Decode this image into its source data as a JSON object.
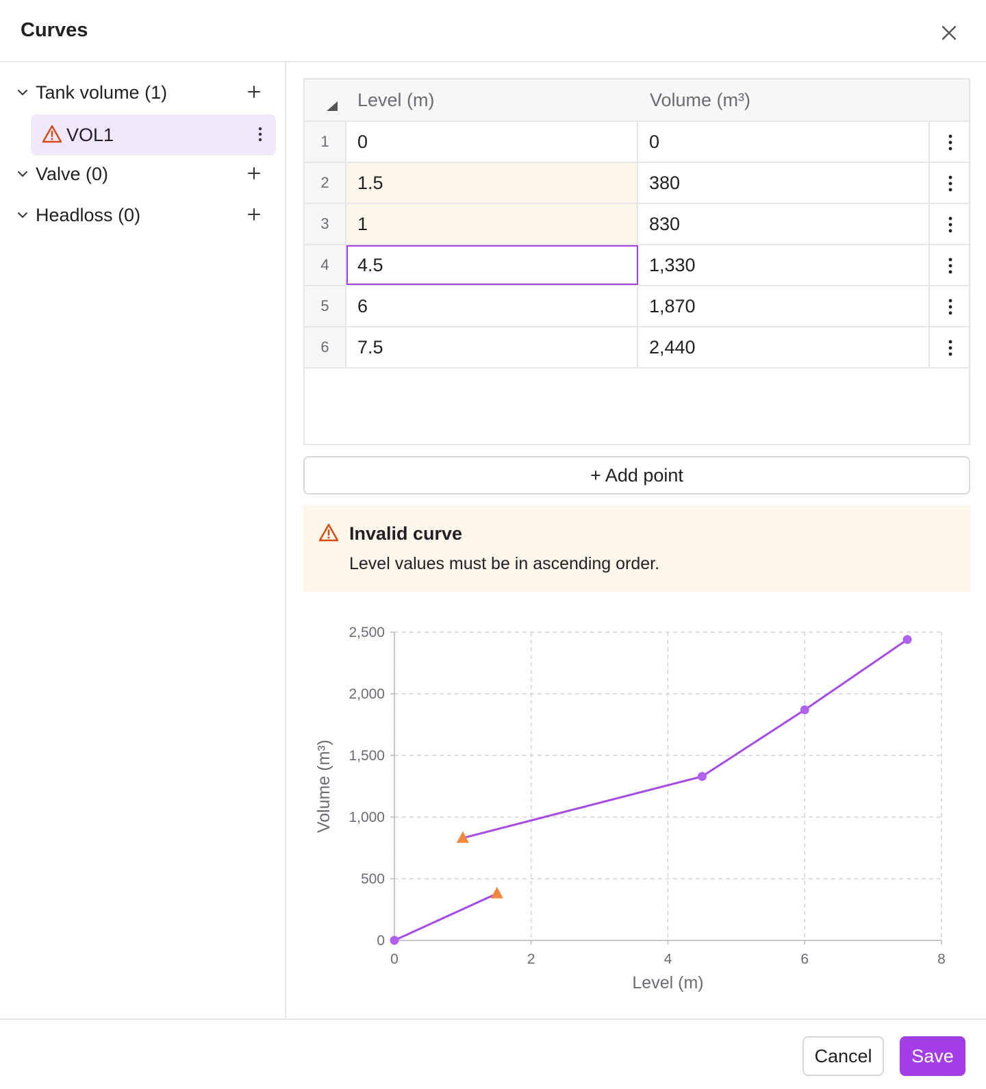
{
  "dialog": {
    "title": "Curves"
  },
  "sidebar": {
    "groups": [
      {
        "label": "Tank volume (1)"
      },
      {
        "label": "Valve (0)"
      },
      {
        "label": "Headloss (0)"
      }
    ],
    "curves": [
      {
        "label": "VOL1",
        "status": "invalid"
      }
    ]
  },
  "table": {
    "headers": {
      "level": "Level (m)",
      "volume": "Volume (m³)"
    },
    "rows": [
      {
        "n": "1",
        "level": "0",
        "volume": "0"
      },
      {
        "n": "2",
        "level": "1.5",
        "volume": "380"
      },
      {
        "n": "3",
        "level": "1",
        "volume": "830"
      },
      {
        "n": "4",
        "level": "4.5",
        "volume": "1,330"
      },
      {
        "n": "5",
        "level": "6",
        "volume": "1,870"
      },
      {
        "n": "6",
        "level": "7.5",
        "volume": "2,440"
      }
    ]
  },
  "add_point_label": "+ Add point",
  "alert": {
    "title": "Invalid curve",
    "message": "Level values must be in ascending order."
  },
  "footer": {
    "cancel_label": "Cancel",
    "save_label": "Save"
  },
  "colors": {
    "accent": "#a33ee6",
    "line": "#a44be8",
    "point": "#b061f0",
    "invalid_point": "#f0883e",
    "warning": "#d9480f"
  },
  "chart_data": {
    "type": "line",
    "xlabel": "Level (m)",
    "ylabel": "Volume (m³)",
    "xlim": [
      0,
      8
    ],
    "ylim": [
      0,
      2500
    ],
    "xticks": [
      "0",
      "2",
      "4",
      "6",
      "8"
    ],
    "yticks": [
      "0",
      "500",
      "1,000",
      "1,500",
      "2,000",
      "2,500"
    ],
    "grid": true,
    "points": [
      {
        "x": 0,
        "y": 0,
        "valid": true
      },
      {
        "x": 1.5,
        "y": 380,
        "valid": false
      },
      {
        "x": 1,
        "y": 830,
        "valid": false
      },
      {
        "x": 4.5,
        "y": 1330,
        "valid": true
      },
      {
        "x": 6,
        "y": 1870,
        "valid": true
      },
      {
        "x": 7.5,
        "y": 2440,
        "valid": true
      }
    ]
  }
}
